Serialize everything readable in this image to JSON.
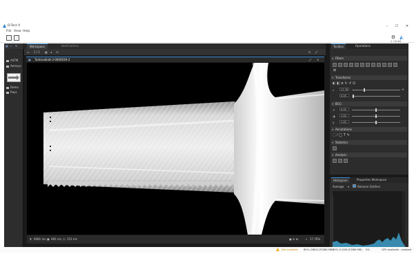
{
  "window": {
    "title": "D-Tect X",
    "minimize": "–",
    "maximize": "☐",
    "close": "✕"
  },
  "menu": [
    "File",
    "View",
    "Help"
  ],
  "toolbar_right": {
    "alerts_text": "1 ⓘ0 ⊘0"
  },
  "left_nav": {
    "search_icon": "⌕",
    "items": [
      {
        "label": "ASTM"
      },
      {
        "label": "Aerosys"
      },
      {
        "label": "Demo"
      },
      {
        "label": "Rays"
      }
    ]
  },
  "workspace": {
    "tabs": [
      {
        "label": "Workspace",
        "active": true
      },
      {
        "label": "Notifications",
        "active": false
      }
    ],
    "page_indicator": "1 / 1",
    "image_tab_label": "Turbineblatt-3-0000039-3",
    "status": {
      "time1": "6081 ms",
      "time2": "481 ms",
      "time3": "151 ms",
      "zoom": "17.76%"
    }
  },
  "toolbox": {
    "tabs": [
      {
        "label": "Toolbox",
        "active": true
      },
      {
        "label": "Operations",
        "active": false
      }
    ],
    "sections": {
      "filters": "Filters",
      "transform": "Transforms",
      "bcg": "BCG",
      "annotations": "Annotations",
      "statistics": "Statistics",
      "analysis": "Analysis"
    },
    "transform_rotation": "17.76",
    "transform_second": "0.00",
    "bcg_values": [
      "0.00",
      "1.00",
      "1.00"
    ]
  },
  "histogram": {
    "tabs": [
      {
        "label": "Histogram",
        "active": true
      },
      {
        "label": "Properties Workspace",
        "active": false
      }
    ],
    "mode": "Average",
    "remove_outliers_label": "Remove Outliers",
    "remove_outliers_checked": true
  },
  "statusbar": {
    "warning": "Not available",
    "mem": "85% (28611/33386 MB)",
    "mem2": "85% (11281/33386 MB)",
    "cpu": "0%",
    "gpu": "GPU available - enabled"
  },
  "colors": {
    "accent": "#3a8fd9",
    "histogram_fill": "#3d9fc9",
    "warning": "#f2b01e"
  }
}
